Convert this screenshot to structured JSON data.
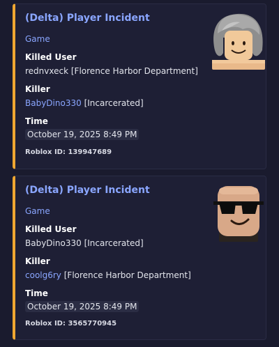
{
  "embeds": [
    {
      "title": "(Delta) Player Incident",
      "link": "Game",
      "killed_user_label": "Killed User",
      "killed_user_name": "rednvxeck",
      "killed_user_tag": "[Florence Harbor Department]",
      "killer_label": "Killer",
      "killer_name": "BabyDino330",
      "killer_tag": "[Incarcerated]",
      "time_label": "Time",
      "time_value": "October 19, 2025 8:49 PM",
      "footer": "Roblox ID: 139947689",
      "thumbnail": "avatar-gray-hair-icon"
    },
    {
      "title": "(Delta) Player Incident",
      "link": "Game",
      "killed_user_label": "Killed User",
      "killed_user_name": "BabyDino330",
      "killed_user_tag": "[Incarcerated]",
      "killer_label": "Killer",
      "killer_name": "coolg6ry",
      "killer_tag": "[Florence Harbor Department]",
      "time_label": "Time",
      "time_value": "October 19, 2025 8:49 PM",
      "footer": "Roblox ID: 3565770945",
      "thumbnail": "avatar-sunglasses-icon"
    }
  ],
  "colors": {
    "accent_bar": "#f0a731",
    "link": "#8aa6ff",
    "background": "#1a1b2e",
    "embed_background": "#1e1f35"
  }
}
